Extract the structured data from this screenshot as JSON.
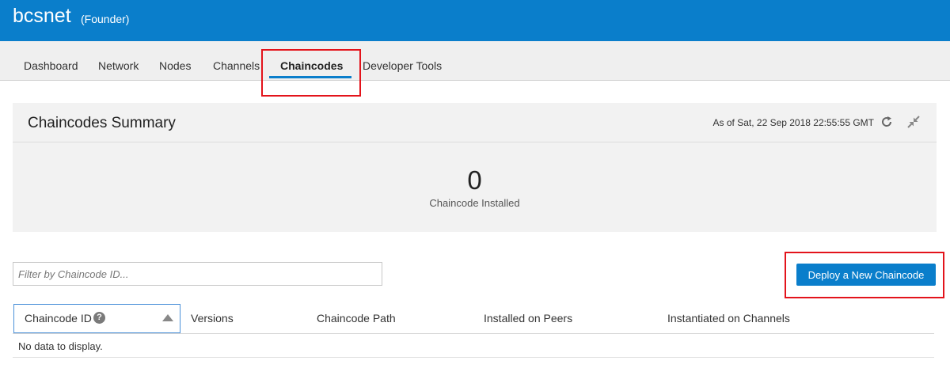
{
  "header": {
    "network_name": "bcsnet",
    "role": "(Founder)"
  },
  "nav": {
    "tabs": [
      {
        "label": "Dashboard"
      },
      {
        "label": "Network"
      },
      {
        "label": "Nodes"
      },
      {
        "label": "Channels"
      },
      {
        "label": "Chaincodes"
      },
      {
        "label": "Developer Tools"
      }
    ],
    "active_tab": "Chaincodes"
  },
  "summary": {
    "title": "Chaincodes Summary",
    "as_of": "As of Sat, 22 Sep 2018 22:55:55 GMT",
    "count": "0",
    "count_label": "Chaincode Installed",
    "refresh_icon": "refresh-icon",
    "collapse_icon": "collapse-icon"
  },
  "filter": {
    "placeholder": "Filter by Chaincode ID...",
    "value": ""
  },
  "actions": {
    "deploy_label": "Deploy a New Chaincode"
  },
  "table": {
    "columns": [
      {
        "label": "Chaincode ID"
      },
      {
        "label": "Versions"
      },
      {
        "label": "Chaincode Path"
      },
      {
        "label": "Installed on Peers"
      },
      {
        "label": "Instantiated on Channels"
      }
    ],
    "sort_direction": "ascending",
    "help_icon_glyph": "?",
    "empty_message": "No data to display."
  },
  "colors": {
    "brand_blue": "#0a7ecb",
    "annotation_red": "#e3131b",
    "panel_gray": "#f2f2f2"
  }
}
